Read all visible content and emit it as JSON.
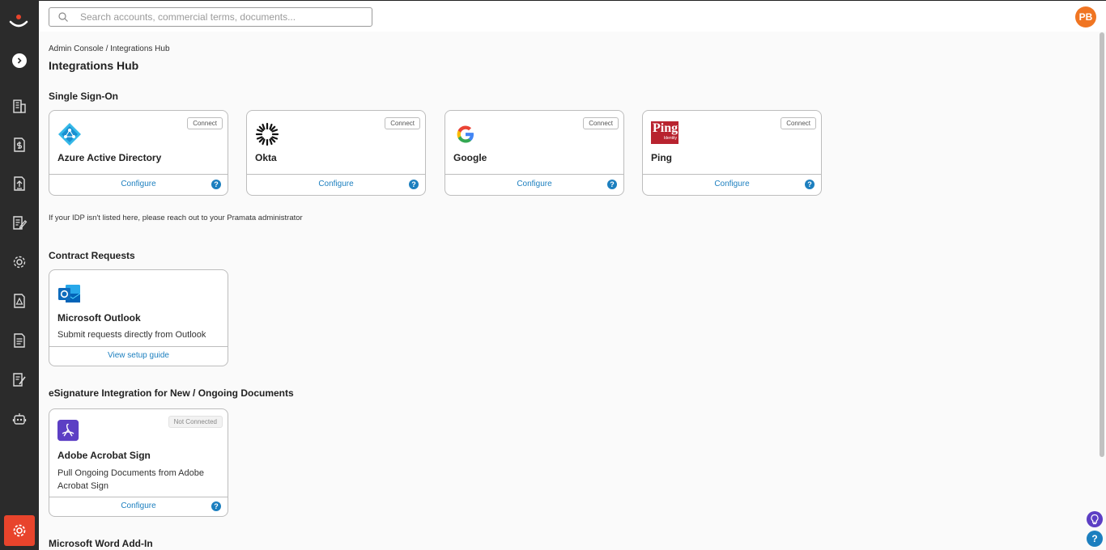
{
  "search": {
    "placeholder": "Search accounts, commercial terms, documents..."
  },
  "user": {
    "initials": "PB"
  },
  "breadcrumb": "Admin Console / Integrations Hub",
  "page_title": "Integrations Hub",
  "sections": {
    "sso": {
      "title": "Single Sign-On",
      "note": "If your IDP isn't listed here, please reach out to your Pramata administrator",
      "cards": [
        {
          "name": "Azure Active Directory",
          "status": "Connect",
          "link": "Configure",
          "logo": "azure-logo"
        },
        {
          "name": "Okta",
          "status": "Connect",
          "link": "Configure",
          "logo": "okta-logo"
        },
        {
          "name": "Google",
          "status": "Connect",
          "link": "Configure",
          "logo": "google-logo"
        },
        {
          "name": "Ping",
          "status": "Connect",
          "link": "Configure",
          "logo": "ping-logo",
          "logo_text": "Ping",
          "logo_subtext": "Identity"
        }
      ]
    },
    "contract_requests": {
      "title": "Contract Requests",
      "cards": [
        {
          "name": "Microsoft Outlook",
          "description": "Submit requests directly from Outlook",
          "link": "View setup guide",
          "logo": "outlook-logo"
        }
      ]
    },
    "esignature": {
      "title": "eSignature Integration for New / Ongoing Documents",
      "cards": [
        {
          "name": "Adobe Acrobat Sign",
          "status": "Not Connected",
          "description": "Pull Ongoing Documents from Adobe Acrobat Sign",
          "link": "Configure",
          "logo": "adobe-sign-logo"
        }
      ]
    },
    "word_addin": {
      "title": "Microsoft Word Add-In"
    }
  },
  "help_glyph": "?",
  "colors": {
    "sidebar": "#2b2b2b",
    "accent": "#e8442c",
    "link": "#1c7fbf",
    "avatar": "#f07522"
  }
}
